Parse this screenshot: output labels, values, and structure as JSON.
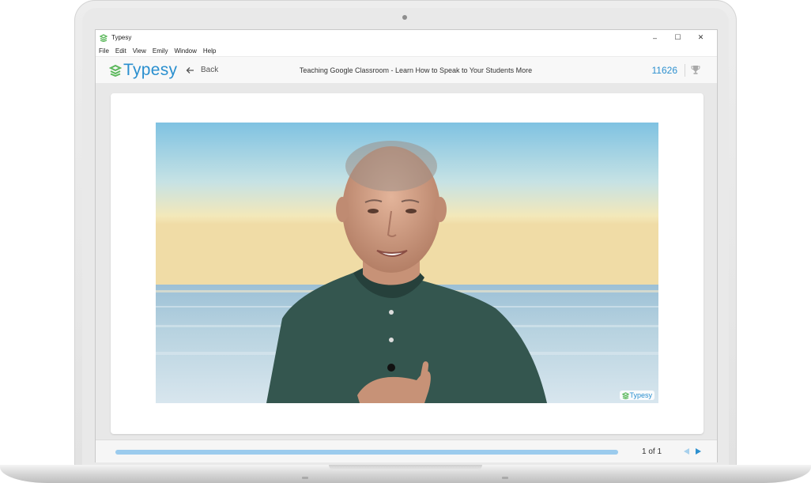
{
  "window": {
    "title": "Typesy",
    "controls": {
      "minimize": "–",
      "maximize": "☐",
      "close": "✕"
    }
  },
  "menu": [
    "File",
    "Edit",
    "View",
    "Emily",
    "Window",
    "Help"
  ],
  "toolbar": {
    "brand": "Typesy",
    "back_label": "Back",
    "course_title": "Teaching Google Classroom - Learn How to Speak to Your Students More",
    "points": "11626",
    "trophy_icon": "trophy-icon"
  },
  "video": {
    "watermark": "Typesy"
  },
  "footer": {
    "page_indicator": "1 of 1",
    "progress": 1.0
  },
  "colors": {
    "brand_blue": "#2a8fcf",
    "brand_green": "#5cb85c",
    "progress": "#9bcbed"
  }
}
